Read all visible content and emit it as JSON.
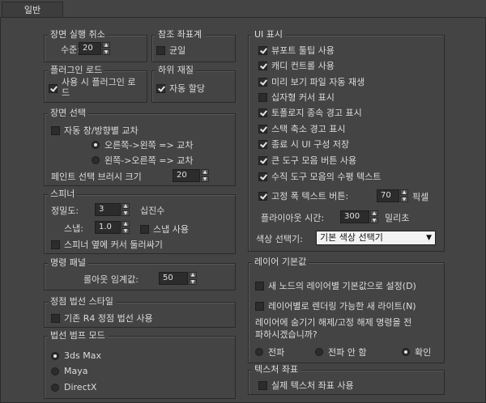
{
  "tab": {
    "label": "일반"
  },
  "undo": {
    "title": "장면 실행 취소",
    "level_label": "수준:",
    "level_value": "20"
  },
  "ref": {
    "title": "참조 좌표계",
    "uniform_label": "균일",
    "uniform_checked": false
  },
  "plugin": {
    "title": "플러그인 로드",
    "load_on_use_label": "사용 시 플러그인 로드",
    "load_on_use_checked": true
  },
  "submat": {
    "title": "하위 재질",
    "auto_assign_label": "자동 할당",
    "auto_assign_checked": true
  },
  "scenesel": {
    "title": "장면 선택",
    "auto_window_label": "자동 창/방향별 교차",
    "auto_window_checked": false,
    "radio1_label": "오른쪽->왼쪽 => 교차",
    "radio1_on": true,
    "radio2_label": "왼쪽->오른쪽 => 교차",
    "radio2_on": false,
    "paint_brush_label": "페인트 선택 브러시 크기",
    "paint_brush_value": "20"
  },
  "spinner": {
    "title": "스피너",
    "precision_label": "정밀도:",
    "precision_value": "3",
    "decimals_label": "십진수",
    "snap_label": "스냅:",
    "snap_value": "1.0",
    "snap_use_label": "스냅 사용",
    "snap_use_checked": false,
    "wrap_label": "스피너 옆에 커서 둘러싸기",
    "wrap_checked": false
  },
  "cmdpanel": {
    "title": "명령 패널",
    "rollout_label": "롤아웃 임계값:",
    "rollout_value": "50"
  },
  "vertex": {
    "title": "정점 법선 스타일",
    "legacy_label": "기존 R4 정점 법선 사용",
    "legacy_checked": false
  },
  "bump": {
    "title": "법선 범프 모드",
    "options": [
      {
        "label": "3ds Max",
        "on": true
      },
      {
        "label": "Maya",
        "on": false
      },
      {
        "label": "DirectX",
        "on": false
      }
    ]
  },
  "ui": {
    "title": "UI 표시",
    "items": [
      {
        "label": "뷰포트 툴팁 사용",
        "checked": true
      },
      {
        "label": "캐디 컨트롤 사용",
        "checked": true
      },
      {
        "label": "미리 보기 파일 자동 재생",
        "checked": true
      },
      {
        "label": "십자형 커서 표시",
        "checked": false
      },
      {
        "label": "토폴로지 종속 경고 표시",
        "checked": true
      },
      {
        "label": "스택 축소 경고 표시",
        "checked": true
      },
      {
        "label": "종료 시 UI 구성 저장",
        "checked": true
      },
      {
        "label": "큰 도구 모음 버튼 사용",
        "checked": true
      },
      {
        "label": "수직 도구 모음의 수평 텍스트",
        "checked": true
      }
    ],
    "fixed_width_label": "고정 폭 텍스트 버튼:",
    "fixed_width_checked": true,
    "fixed_width_value": "70",
    "pixel_label": "픽셀",
    "flyout_label": "플라이아웃 시간:",
    "flyout_value": "300",
    "ms_label": "밀리초",
    "color_picker_label": "색상 선택기:",
    "color_picker_value": "기본 색상 선택기"
  },
  "layer": {
    "title": "레이어 기본값",
    "default_label": "새 노드의 레이어별 기본값으로 설정(D)",
    "default_checked": false,
    "light_label": "레이어별로 렌더링 가능한 새 라이트(N)",
    "light_checked": false,
    "prompt_line1": "레이어에 숨기기 해제/고정 해제 명령을 전",
    "prompt_line2": "파하시겠습니까?",
    "options": [
      {
        "label": "전파",
        "on": false
      },
      {
        "label": "전파 안 함",
        "on": false
      },
      {
        "label": "확인",
        "on": true
      }
    ]
  },
  "texcoord": {
    "title": "텍스처 좌표",
    "real_label": "실제 텍스처 좌표 사용",
    "real_checked": false
  }
}
